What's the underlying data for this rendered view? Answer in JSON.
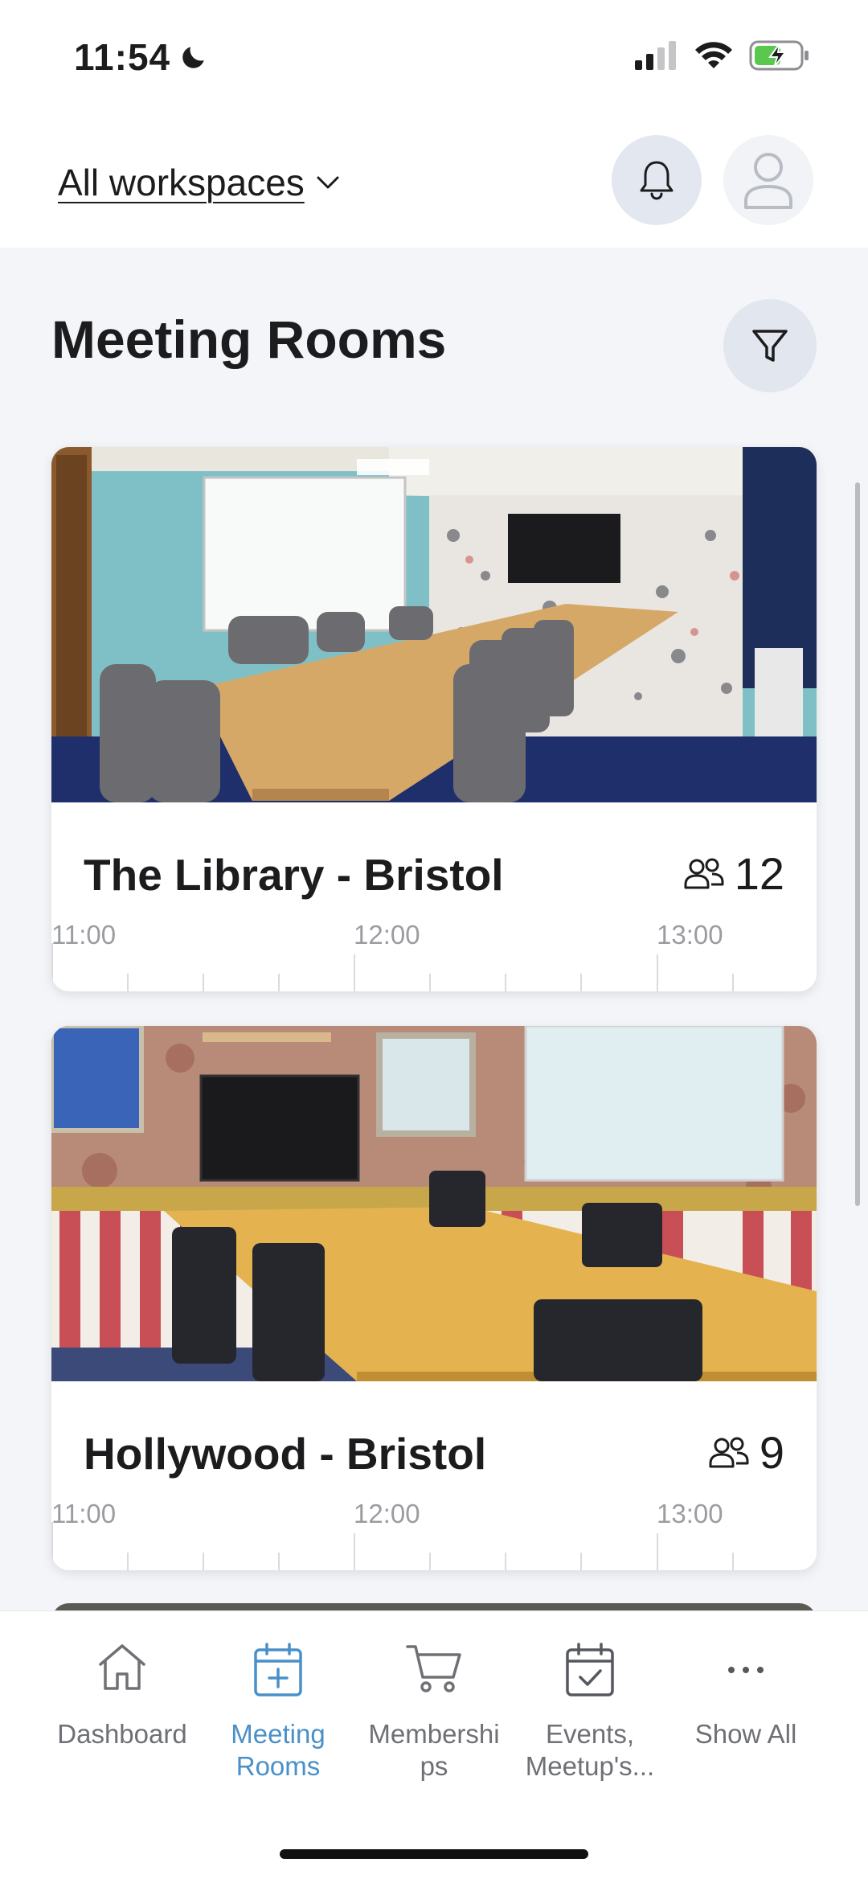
{
  "status_bar": {
    "time": "11:54"
  },
  "header": {
    "workspace_label": "All workspaces"
  },
  "page": {
    "title": "Meeting Rooms"
  },
  "rooms": [
    {
      "name": "The Library - Bristol",
      "capacity": "12",
      "timeline": [
        "11:00",
        "12:00",
        "13:00"
      ]
    },
    {
      "name": "Hollywood - Bristol",
      "capacity": "9",
      "timeline": [
        "11:00",
        "12:00",
        "13:00"
      ]
    }
  ],
  "tabs": [
    {
      "label": "Dashboard",
      "icon": "home-icon"
    },
    {
      "label": "Meeting\nRooms",
      "icon": "calendar-plus-icon"
    },
    {
      "label": "Membershi\nps",
      "icon": "cart-icon"
    },
    {
      "label": "Events,\nMeetup's...",
      "icon": "calendar-check-icon"
    },
    {
      "label": "Show All",
      "icon": "more-icon"
    }
  ],
  "colors": {
    "accent": "#4a90c8",
    "background": "#f3f5f8",
    "text": "#1c1c1e",
    "muted": "#6e7075"
  }
}
